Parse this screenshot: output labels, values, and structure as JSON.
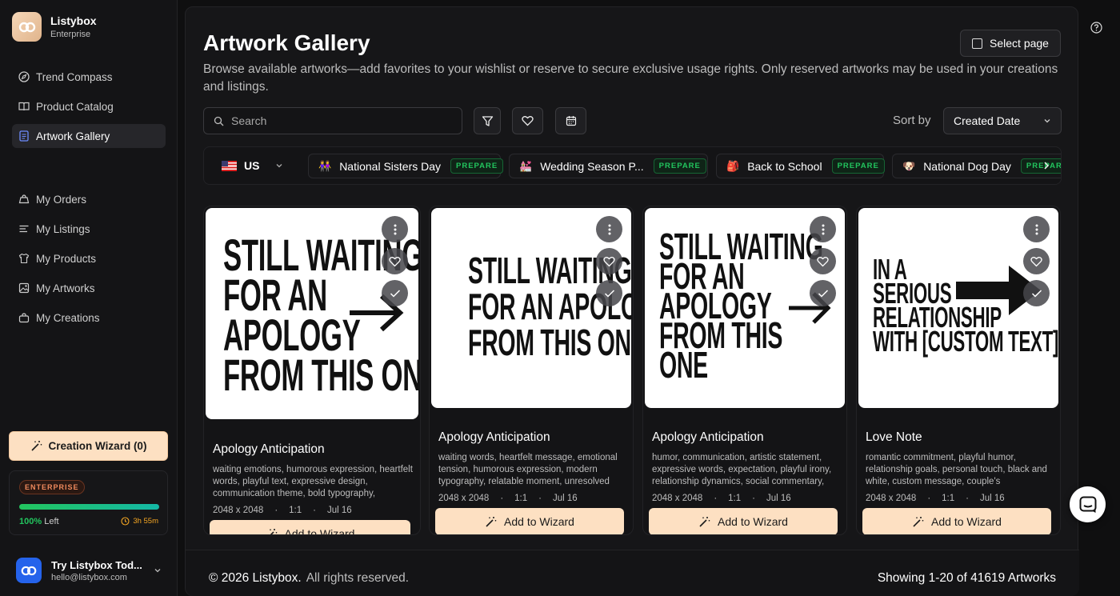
{
  "app": {
    "name": "Listybox",
    "plan": "Enterprise"
  },
  "nav": {
    "primary": [
      {
        "label": "Trend Compass",
        "icon": "compass-icon"
      },
      {
        "label": "Product Catalog",
        "icon": "book-icon"
      },
      {
        "label": "Artwork Gallery",
        "icon": "gallery-icon",
        "active": true
      }
    ],
    "secondary": [
      {
        "label": "My Orders",
        "icon": "orders-icon"
      },
      {
        "label": "My Listings",
        "icon": "listings-icon"
      },
      {
        "label": "My Products",
        "icon": "products-icon"
      },
      {
        "label": "My Artworks",
        "icon": "artworks-icon"
      },
      {
        "label": "My Creations",
        "icon": "creations-icon"
      }
    ]
  },
  "wizard_button": "Creation Wizard (0)",
  "plan_card": {
    "badge": "ENTERPRISE",
    "progress_percent": 100,
    "percent_label": "100%",
    "left_label": "Left",
    "time_left": "3h 55m"
  },
  "user": {
    "name": "Try Listybox Tod...",
    "email": "hello@listybox.com"
  },
  "page": {
    "title": "Artwork Gallery",
    "description": "Browse available artworks—add favorites to your wishlist or reserve to secure exclusive usage rights. Only reserved artworks may be used in your creations and listings.",
    "select_page": "Select page"
  },
  "search": {
    "placeholder": "Search"
  },
  "sort": {
    "label": "Sort by",
    "value": "Created Date"
  },
  "country": "US",
  "events": [
    {
      "emoji": "👭",
      "name": "National Sisters Day",
      "badge": "PREPARE"
    },
    {
      "emoji": "💒",
      "name": "Wedding Season P...",
      "badge": "PREPARE"
    },
    {
      "emoji": "🎒",
      "name": "Back to School",
      "badge": "PREPARE"
    },
    {
      "emoji": "🐶",
      "name": "National Dog Day",
      "badge": "PREPARE"
    }
  ],
  "cards": [
    {
      "title": "Apology Anticipation",
      "art_lines": [
        "STILL WAITING",
        "FOR AN",
        "APOLOGY",
        "FROM THIS ONE"
      ],
      "tags": "waiting emotions, humorous expression, heartfelt words, playful text, expressive design, communication theme, bold typography,",
      "size": "2048 x 2048",
      "ratio": "1:1",
      "date": "Jul 16",
      "button": "Add to Wizard"
    },
    {
      "title": "Apology Anticipation",
      "art_lines": [
        "STILL WAITING",
        "FOR AN APOLOGY",
        "FROM THIS ONE→"
      ],
      "tags": "waiting words, heartfelt message, emotional tension, humorous expression, modern typography, relatable moment, unresolved",
      "size": "2048 x 2048",
      "ratio": "1:1",
      "date": "Jul 16",
      "button": "Add to Wizard"
    },
    {
      "title": "Apology Anticipation",
      "art_lines": [
        "STILL WAITING",
        "FOR AN",
        "APOLOGY",
        "FROM THIS",
        "ONE"
      ],
      "tags": "humor, communication, artistic statement, expressive words, expectation, playful irony, relationship dynamics, social commentary,",
      "size": "2048 x 2048",
      "ratio": "1:1",
      "date": "Jul 16",
      "button": "Add to Wizard"
    },
    {
      "title": "Love Note",
      "art_lines": [
        "IN A",
        "SERIOUS",
        "RELATIONSHIP",
        "WITH [CUSTOM TEXT]"
      ],
      "tags": "romantic commitment, playful humor, relationship goals, personal touch, black and white, custom message, couple's",
      "size": "2048 x 2048",
      "ratio": "1:1",
      "date": "Jul 16",
      "button": "Add to Wizard"
    }
  ],
  "footer": {
    "copyright": "© 2026 Listybox.",
    "rights": "All rights reserved.",
    "showing": "Showing 1-20 of 41619 Artworks"
  }
}
